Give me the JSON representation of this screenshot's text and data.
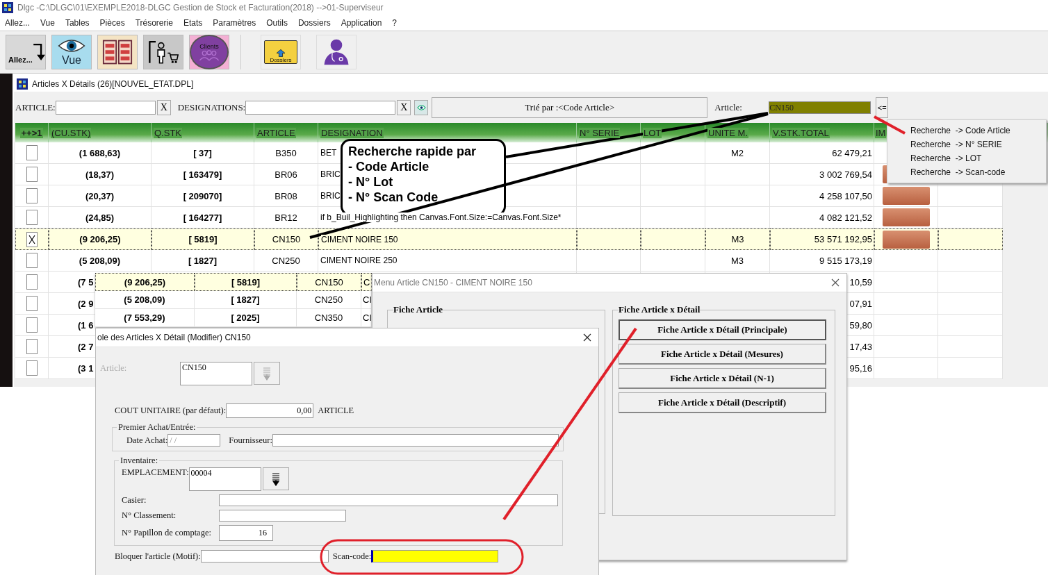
{
  "window": {
    "title": "Dlgc -C:\\DLGC\\01\\EXEMPLE2018-DLGC Gestion de Stock et Facturation(2018) -->01-Superviseur"
  },
  "menu": [
    "Allez...",
    "Vue",
    "Tables",
    "Pièces",
    "Trésorerie",
    "Etats",
    "Paramètres",
    "Outils",
    "Dossiers",
    "Application",
    "?"
  ],
  "toolbar": [
    {
      "kind": "goto",
      "label": "Allez..."
    },
    {
      "kind": "view",
      "label": "Vue"
    },
    {
      "kind": "grid"
    },
    {
      "kind": "shop"
    },
    {
      "kind": "clients",
      "label": "Clients"
    },
    {
      "kind": "folder",
      "label": "Dossiers"
    },
    {
      "kind": "doctor"
    }
  ],
  "articles_window": {
    "title": "Articles X Détails (26)[NOUVEL_ETAT.DPL]",
    "filters": {
      "article_label": "ARTICLE:",
      "article_clear": "X",
      "designations_label": "DESIGNATIONS:",
      "designations_clear": "X",
      "sort_button": "Trié par :<Code Article>",
      "search_label": "Article:",
      "search_value": "CN150",
      "search_highlighted": true,
      "search_button": "<="
    },
    "columns": [
      "++>1",
      "(CU.STK)",
      "Q.STK",
      "ARTICLE",
      "DESIGNATION",
      "N° SERIE",
      "LOT",
      "UNITE M.",
      "V.STK.TOTAL",
      "IM"
    ],
    "rows": [
      {
        "kind": "full",
        "checked": false,
        "selected": false,
        "cu_stk": "(1 688,63)",
        "q_stk": "[ 37]",
        "article": "B350",
        "designation": "BET",
        "unit": "M2",
        "total": "62 479,21",
        "photo": false
      },
      {
        "kind": "full",
        "checked": false,
        "selected": false,
        "cu_stk": "(18,37)",
        "q_stk": "[ 163479]",
        "article": "BR06",
        "designation": "BRIC",
        "unit": "",
        "total": "3 002 769,54",
        "photo": true
      },
      {
        "kind": "full",
        "checked": false,
        "selected": false,
        "cu_stk": "(20,37)",
        "q_stk": "[ 209070]",
        "article": "BR08",
        "designation": "BRIC",
        "unit": "",
        "total": "4 258 107,50",
        "photo": true
      },
      {
        "kind": "full",
        "checked": false,
        "selected": false,
        "cu_stk": "(24,85)",
        "q_stk": "[ 164277]",
        "article": "BR12",
        "designation": "if b_Buil_Highlighting then  Canvas.Font.Size:=Canvas.Font.Size*",
        "unit": "",
        "total": "4 082 121,52",
        "photo": true
      },
      {
        "kind": "full",
        "checked": true,
        "selected": true,
        "cu_stk": "(9 206,25)",
        "q_stk": "[ 5819]",
        "article": "CN150",
        "designation": "CIMENT NOIRE 150",
        "unit": "M3",
        "total": "53 571 192,95",
        "photo": true
      },
      {
        "kind": "full",
        "checked": false,
        "selected": false,
        "cu_stk": "(5 208,09)",
        "q_stk": "[ 1827]",
        "article": "CN250",
        "designation": "CIMENT NOIRE 250",
        "unit": "M3",
        "total": "9 515 173,19",
        "photo": false
      },
      {
        "kind": "clipped",
        "checked": false,
        "selected": false,
        "cu_stk": "(7 5",
        "total": "10,59"
      },
      {
        "kind": "clipped",
        "checked": false,
        "selected": false,
        "cu_stk": "(2 9",
        "total": "07,91"
      },
      {
        "kind": "clipped",
        "checked": false,
        "selected": false,
        "cu_stk": "(1 6",
        "total": "59,80"
      },
      {
        "kind": "clipped",
        "checked": false,
        "selected": false,
        "cu_stk": "(2 7",
        "total": "17,43"
      },
      {
        "kind": "clipped",
        "checked": false,
        "selected": false,
        "cu_stk": "(3 1",
        "total": "95,16"
      }
    ]
  },
  "search_menu": {
    "items": [
      "Recherche  -> Code Article",
      "Recherche  -> N° SERIE",
      "Recherche  -> LOT",
      "Recherche  -> Scan-code"
    ]
  },
  "overlay_strip": {
    "rows": [
      {
        "selected": true,
        "cells": [
          "(9 206,25)",
          "[ 5819]",
          "CN150",
          "C"
        ]
      },
      {
        "selected": false,
        "cells": [
          "(5 208,09)",
          "[ 1827]",
          "CN250",
          "CI"
        ]
      },
      {
        "selected": false,
        "cells": [
          "(7 553,29)",
          "[ 2025]",
          "CN350",
          "CI"
        ]
      }
    ]
  },
  "callout": {
    "lines": [
      "Recherche rapide par",
      "- Code Article",
      "- N° Lot",
      "- N° Scan Code"
    ]
  },
  "menu_article_window": {
    "title": "Menu Article CN150 - CIMENT NOIRE 150",
    "group_1": {
      "title": "Fiche Article"
    },
    "group_2": {
      "title": "Fiche Article x Détail",
      "buttons": [
        {
          "label": "Fiche Article x Détail (Principale)",
          "default": true
        },
        {
          "label": "Fiche Article x Détail (Mesures)",
          "default": false
        },
        {
          "label": "Fiche Article x Détail (N-1)",
          "default": false
        },
        {
          "label": "Fiche Article x Détail (Descriptif)",
          "default": false
        }
      ]
    }
  },
  "modifier_window": {
    "title": "ole des Articles X Détail (Modifier) CN150",
    "article": {
      "label": "Article:",
      "value": "CN150",
      "disabled": true
    },
    "unit_cost": {
      "label": "COUT UNITAIRE (par défaut):",
      "value": "0,00",
      "suffix": "ARTICLE"
    },
    "first_purchase": {
      "title": "Premier Achat/Entrée:",
      "date_label": "Date Achat:",
      "date_value": "/ /",
      "supplier_label": "Fournisseur:"
    },
    "inventory": {
      "title": "Inventaire:",
      "location_label": "EMPLACEMENT:",
      "location_value": "00004",
      "location_disabled": false,
      "bin_label": "Casier:",
      "class_label": "N° Classement:",
      "count_label": "N° Papillon de comptage:",
      "count_value": "16"
    },
    "block_label": "Bloquer l'article (Motif):",
    "scan": {
      "label": "Scan-code:",
      "highlighted": true
    }
  }
}
